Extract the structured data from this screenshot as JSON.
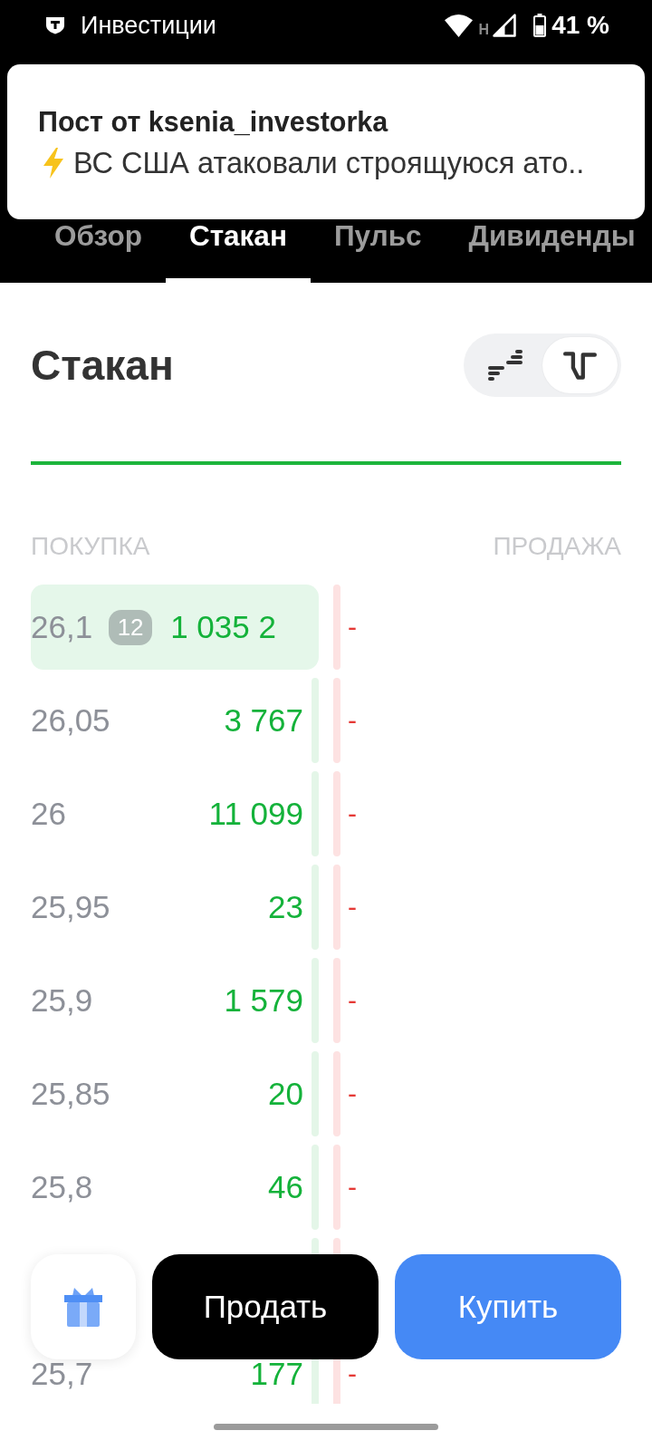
{
  "status_bar": {
    "app_name": "Инвестиции",
    "network_type": "H",
    "battery": "41 %"
  },
  "notification": {
    "title": "Пост от ksenia_investorka",
    "body": "ВС США атаковали строящуюся ато.."
  },
  "tabs": [
    {
      "label": "Обзор",
      "selected": false
    },
    {
      "label": "Стакан",
      "selected": true
    },
    {
      "label": "Пульс",
      "selected": false
    },
    {
      "label": "Дивиденды",
      "selected": false
    }
  ],
  "order_book": {
    "title": "Стакан",
    "view_toggle": [
      {
        "kind": "list",
        "selected": false
      },
      {
        "kind": "depth",
        "selected": true
      }
    ],
    "bid_header": "ПОКУПКА",
    "ask_header": "ПРОДАЖА",
    "rows": [
      {
        "kind": "level",
        "price": "26,1",
        "badge": "12",
        "volume": "1 035 2",
        "ask": "-",
        "highlighted": true
      },
      {
        "kind": "level",
        "price": "26,05",
        "volume": "3 767",
        "ask": "-",
        "highlighted": false
      },
      {
        "kind": "level",
        "price": "26",
        "volume": "11 099",
        "ask": "-",
        "highlighted": false
      },
      {
        "kind": "level",
        "price": "25,95",
        "volume": "23",
        "ask": "-",
        "highlighted": false
      },
      {
        "kind": "level",
        "price": "25,9",
        "volume": "1 579",
        "ask": "-",
        "highlighted": false
      },
      {
        "kind": "level",
        "price": "25,85",
        "volume": "20",
        "ask": "-",
        "highlighted": false
      },
      {
        "kind": "level",
        "price": "25,8",
        "volume": "46",
        "ask": "-",
        "highlighted": false
      },
      {
        "kind": "covered"
      },
      {
        "kind": "level",
        "price": "25,7",
        "volume": "177",
        "ask": "-",
        "highlighted": false
      }
    ]
  },
  "actions": [
    {
      "kind": "gift"
    },
    {
      "kind": "sell",
      "label": "Продать"
    },
    {
      "kind": "buy",
      "label": "Купить"
    }
  ]
}
